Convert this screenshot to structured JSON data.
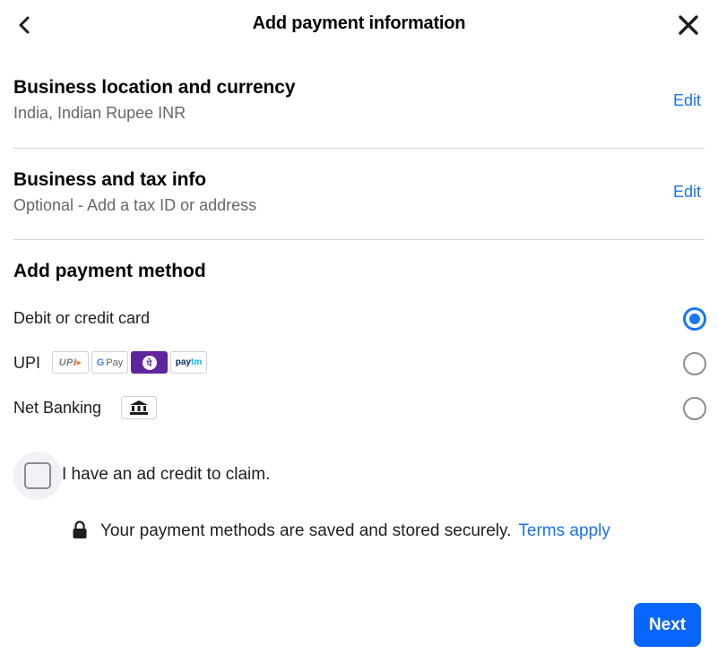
{
  "header": {
    "title": "Add payment information",
    "back_icon": "chevron-left-icon",
    "close_icon": "close-icon"
  },
  "sections": [
    {
      "title": "Business location and currency",
      "subtitle": "India, Indian Rupee INR",
      "action": "Edit"
    },
    {
      "title": "Business and tax info",
      "subtitle": "Optional - Add a tax ID or address",
      "action": "Edit"
    }
  ],
  "payment_method": {
    "title": "Add payment method",
    "options": [
      {
        "label": "Debit or credit card",
        "selected": true
      },
      {
        "label": "UPI",
        "selected": false,
        "logos": [
          "UPI",
          "G Pay",
          "PhonePe",
          "Paytm"
        ]
      },
      {
        "label": "Net Banking",
        "selected": false,
        "icon": "bank-icon"
      }
    ]
  },
  "upi_logos": {
    "upi": "UPI",
    "gpay_g": "G",
    "gpay_text": "Pay",
    "phonepe": "पे",
    "paytm_pay": "pay",
    "paytm_tm": "tm"
  },
  "credit": {
    "label": "I have an ad credit to claim.",
    "checked": false
  },
  "security": {
    "text": "Your payment methods are saved and stored securely.",
    "link": "Terms apply"
  },
  "footer": {
    "next_label": "Next"
  },
  "colors": {
    "accent": "#0866ff",
    "link": "#1a73e8",
    "radio_selected": "#1877f2",
    "phonepe": "#5f259f"
  }
}
